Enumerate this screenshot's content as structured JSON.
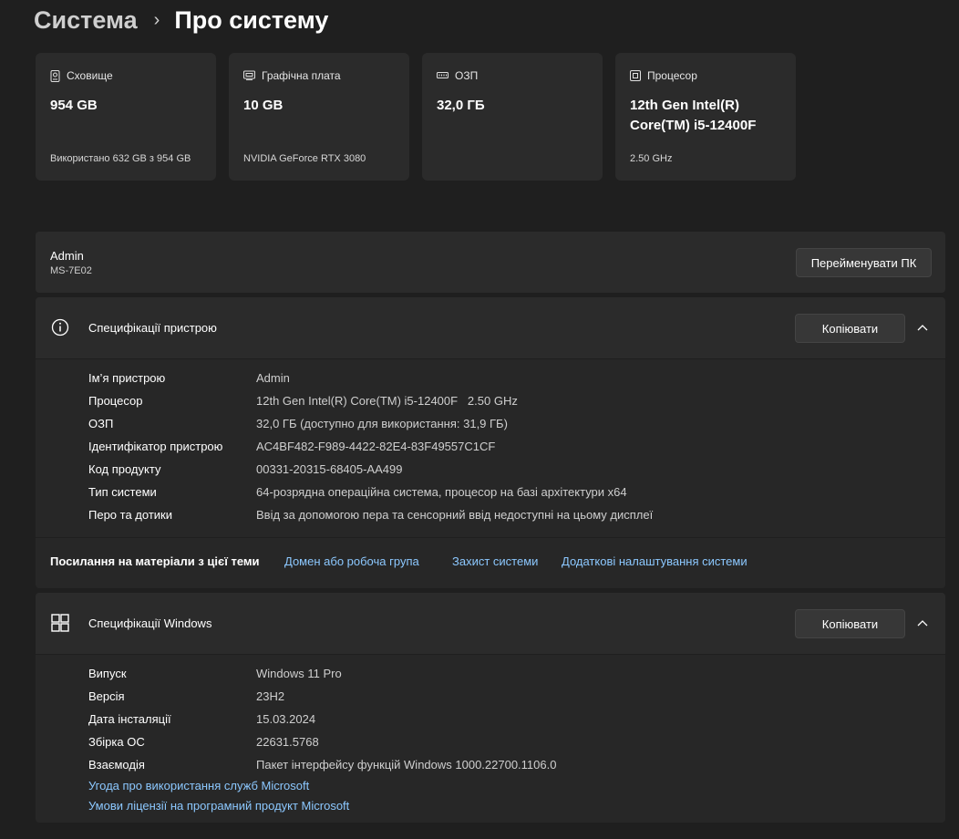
{
  "breadcrumb": {
    "parent": "Система",
    "separator": "›",
    "current": "Про систему"
  },
  "cards": [
    {
      "icon": "storage-icon",
      "label": "Сховище",
      "value": "954 GB",
      "sub": "Використано 632 GB з 954 GB"
    },
    {
      "icon": "graphics-card-icon",
      "label": "Графічна плата",
      "value": "10 GB",
      "sub": "NVIDIA GeForce RTX 3080"
    },
    {
      "icon": "ram-icon",
      "label": "ОЗП",
      "value": "32,0 ГБ",
      "sub": ""
    },
    {
      "icon": "processor-icon",
      "label": "Процесор",
      "value": "12th Gen Intel(R) Core(TM) i5-12400F",
      "sub": "2.50 GHz"
    }
  ],
  "device": {
    "name": "Admin",
    "model": "MS-7E02",
    "rename_label": "Перейменувати ПК"
  },
  "device_specs": {
    "title": "Специфікації пристрою",
    "copy_label": "Копіювати",
    "rows": [
      {
        "label": "Ім’я пристрою",
        "value": "Admin"
      },
      {
        "label": "Процесор",
        "value": "12th Gen Intel(R) Core(TM) i5-12400F   2.50 GHz"
      },
      {
        "label": "ОЗП",
        "value": "32,0 ГБ (доступно для використання: 31,9 ГБ)"
      },
      {
        "label": "Ідентифікатор пристрою",
        "value": "AC4BF482-F989-4422-82E4-83F49557C1CF"
      },
      {
        "label": "Код продукту",
        "value": "00331-20315-68405-AA499"
      },
      {
        "label": "Тип системи",
        "value": "64-розрядна операційна система, процесор на базі архітектури x64"
      },
      {
        "label": "Перо та дотики",
        "value": "Ввід за допомогою пера та сенсорний ввід недоступні на цьому дисплеї"
      }
    ]
  },
  "related_links": {
    "title": "Посилання на матеріали з цієї теми",
    "links": [
      "Домен або робоча група",
      "Захист системи",
      "Додаткові налаштування системи"
    ]
  },
  "windows_specs": {
    "title": "Специфікації Windows",
    "copy_label": "Копіювати",
    "rows": [
      {
        "label": "Випуск",
        "value": "Windows 11 Pro"
      },
      {
        "label": "Версія",
        "value": "23H2"
      },
      {
        "label": "Дата інсталяції",
        "value": "15.03.2024"
      },
      {
        "label": "Збірка ОС",
        "value": "22631.5768"
      },
      {
        "label": "Взаємодія",
        "value": "Пакет інтерфейсу функцій Windows 1000.22700.1106.0"
      }
    ],
    "links": [
      "Угода про використання служб Microsoft",
      "Умови ліцензії на програмний продукт Microsoft"
    ]
  },
  "colors": {
    "background": "#1f1f1f",
    "card": "#2b2b2b",
    "link": "#8cc8ff"
  }
}
